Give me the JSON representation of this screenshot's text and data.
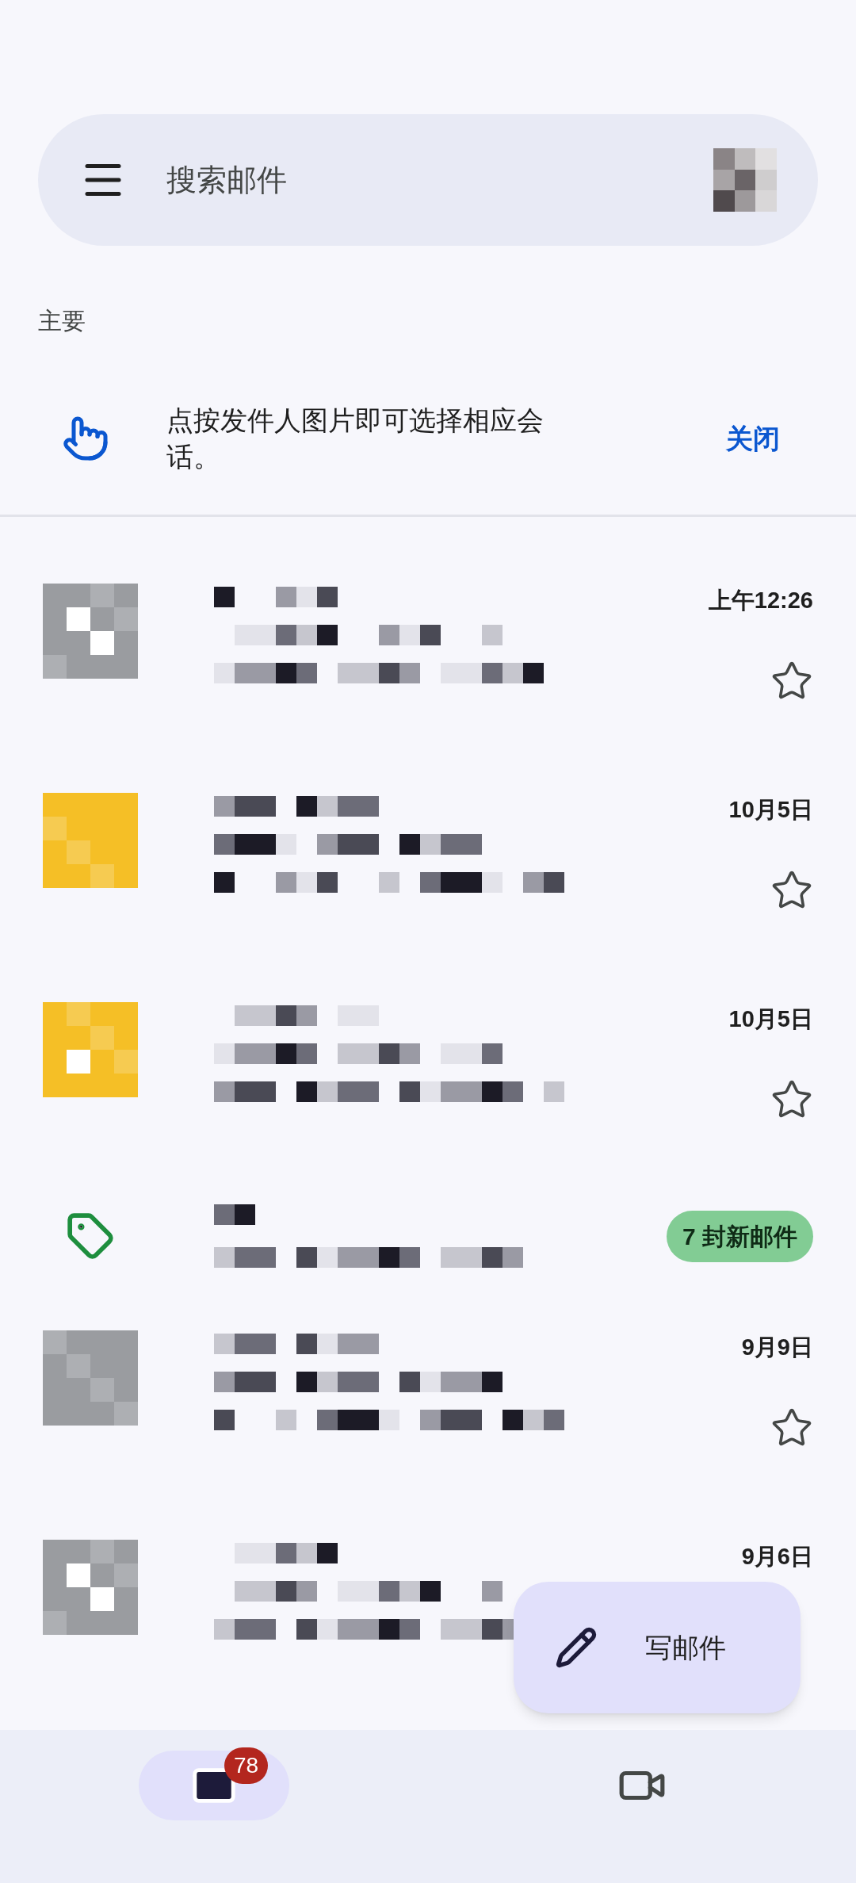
{
  "search": {
    "placeholder": "搜索邮件"
  },
  "section": "主要",
  "tip": {
    "text": "点按发件人图片即可选择相应会话。",
    "action": "关闭"
  },
  "messages": [
    {
      "kind": "mail",
      "color": "#9a9ca0",
      "time": "上午12:26",
      "starred": false
    },
    {
      "kind": "mail",
      "color": "#f5bf26",
      "time": "10月5日",
      "starred": false
    },
    {
      "kind": "mail",
      "color": "#f5bf26",
      "time": "10月5日",
      "starred": false
    },
    {
      "kind": "promo",
      "badge": "7 封新邮件"
    },
    {
      "kind": "mail",
      "color": "#9a9ca0",
      "time": "9月9日",
      "starred": false
    },
    {
      "kind": "mail",
      "color": "#9a9ca0",
      "time": "9月6日"
    }
  ],
  "compose": {
    "label": "写邮件"
  },
  "nav": [
    {
      "kind": "mail",
      "badge": "78",
      "selected": true
    },
    {
      "kind": "video",
      "selected": false
    }
  ]
}
